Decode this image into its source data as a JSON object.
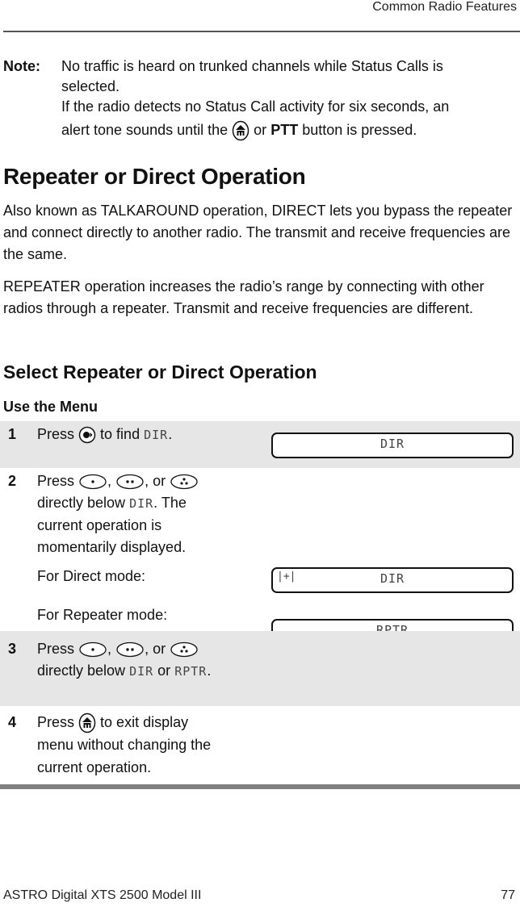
{
  "header": {
    "section_title": "Common Radio Features"
  },
  "note": {
    "label": "Note:",
    "line1": "No traffic is heard on trunked channels while Status Calls is",
    "line2": "selected.",
    "line3": "If the radio detects no Status Call activity for six seconds, an",
    "line4_pre": "alert tone sounds until the",
    "line4_icon": "home-button-icon",
    "line4_mid": "or",
    "line4_bold": "PTT",
    "line4_post": "button is pressed."
  },
  "section": {
    "title": "Repeater or Direct Operation",
    "para1": "Also known as TALKAROUND operation, DIRECT lets you bypass the repeater and connect directly to another radio. The transmit and receive frequencies are the same.",
    "para2": "REPEATER operation increases the radio’s range by connecting with other radios through a repeater. Transmit and receive frequencies are different."
  },
  "subsection": {
    "title": "Select Repeater or Direct Operation",
    "method": "Use the Menu"
  },
  "steps": [
    {
      "num": "1",
      "pre": "Press",
      "icon": "menu-scroll-button-icon",
      "post": "to find",
      "lcd_word": "DIR",
      "end": ".",
      "display": "DIR"
    },
    {
      "num": "2",
      "pre": "Press",
      "sep1": ",",
      "sep2": ", or",
      "line2_pre": "directly below",
      "lcd_word": "DIR",
      "line2_post": ". The",
      "line3": "current operation is",
      "line4": "momentarily displayed.",
      "direct_label": "For Direct mode:",
      "direct_display_icon": "|+|",
      "direct_display": "DIR",
      "repeater_label": "For Repeater mode:",
      "repeater_display": "RPTR"
    },
    {
      "num": "3",
      "pre": "Press",
      "sep1": ",",
      "sep2": ", or",
      "line2_pre": "directly below",
      "lcd_word1": "DIR",
      "mid": "or",
      "lcd_word2": "RPTR",
      "end": "."
    },
    {
      "num": "4",
      "pre": "Press",
      "icon": "home-button-icon",
      "post": "to exit display",
      "line2": "menu without changing the",
      "line3": "current operation."
    }
  ],
  "footer": {
    "product": "ASTRO Digital XTS 2500 Model III",
    "page_number": "77"
  },
  "colors": {
    "shade_row": "#e6e6e6",
    "rule": "#808080"
  }
}
